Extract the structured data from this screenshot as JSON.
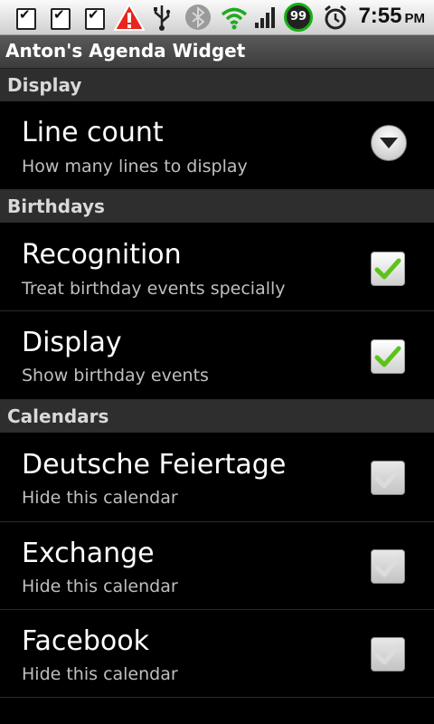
{
  "status_bar": {
    "notifications": [
      "notification-check-icon",
      "notification-check-icon",
      "notification-check-icon"
    ],
    "icons": [
      "warning-icon",
      "usb-icon",
      "bluetooth-icon",
      "wifi-icon",
      "signal-icon",
      "alarm-icon"
    ],
    "battery": "99",
    "time": "7:55",
    "ampm": "PM"
  },
  "app": {
    "title": "Anton's Agenda Widget"
  },
  "sections": {
    "display": "Display",
    "birthdays": "Birthdays",
    "calendars": "Calendars"
  },
  "items": {
    "line_count": {
      "title": "Line count",
      "summary": "How many lines to display",
      "control": "dropdown"
    },
    "recognition": {
      "title": "Recognition",
      "summary": "Treat birthday events specially",
      "checked": true
    },
    "display": {
      "title": "Display",
      "summary": "Show birthday events",
      "checked": true
    },
    "deutsche": {
      "title": "Deutsche Feiertage",
      "summary": "Hide this calendar",
      "checked": false
    },
    "exchange": {
      "title": "Exchange",
      "summary": "Hide this calendar",
      "checked": false
    },
    "facebook": {
      "title": "Facebook",
      "summary": "Hide this calendar",
      "checked": false
    }
  },
  "colors": {
    "check_green": "#5cc317",
    "battery_ring": "#15b015",
    "section_bg": "#2e2e2e"
  }
}
